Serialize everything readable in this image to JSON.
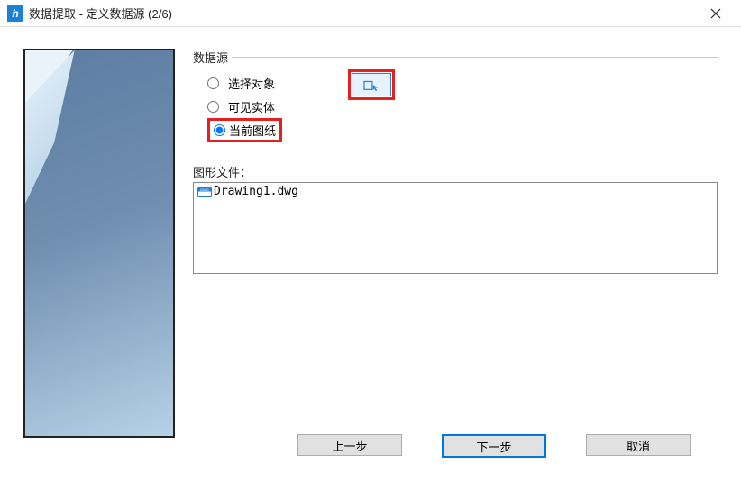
{
  "window": {
    "title": "数据提取 - 定义数据源 (2/6)"
  },
  "source_group": {
    "legend": "数据源",
    "opt_select_objects": "选择对象",
    "opt_visible_entities": "可见实体",
    "opt_current_drawing": "当前图纸"
  },
  "files": {
    "label": "图形文件：",
    "items": [
      "Drawing1.dwg"
    ]
  },
  "buttons": {
    "back": "上一步",
    "next": "下一步",
    "cancel": "取消"
  }
}
